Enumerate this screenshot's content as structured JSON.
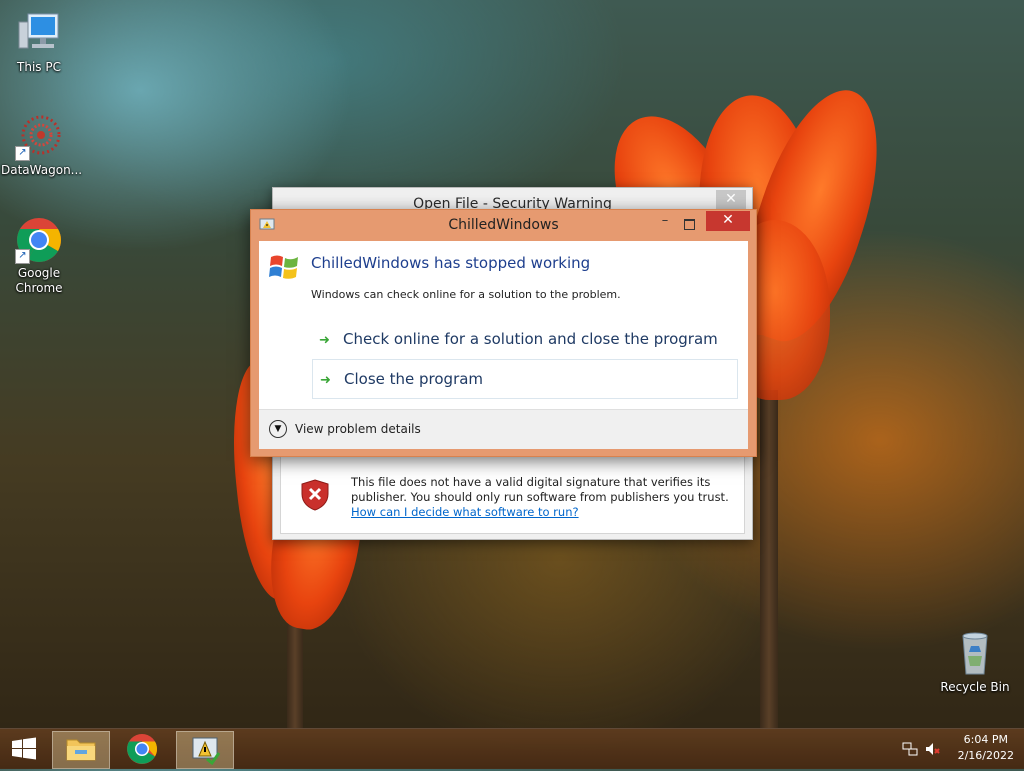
{
  "desktop": {
    "icons": [
      {
        "label": "This PC"
      },
      {
        "label": "DataWagon..."
      },
      {
        "label": "Google Chrome"
      },
      {
        "label": "Recycle Bin"
      }
    ]
  },
  "security_dialog": {
    "title": "Open File - Security Warning",
    "close_glyph": "✕",
    "message": "This file does not have a valid digital signature that verifies its publisher.  You should only run software from publishers you trust.",
    "link": "How can I decide what software to run?"
  },
  "error_dialog": {
    "title": "ChilledWindows",
    "minimize_glyph": "–",
    "close_glyph": "✕",
    "heading": "ChilledWindows has stopped working",
    "subtext": "Windows can check online for a solution to the problem.",
    "option_check": "Check online for a solution and close the program",
    "option_close": "Close the program",
    "details_label": "View problem details"
  },
  "taskbar": {
    "time": "6:04 PM",
    "date": "2/16/2022"
  },
  "colors": {
    "error_frame": "#e69a70",
    "close_red": "#c7372f",
    "link_blue": "#0066cc",
    "heading_blue": "#1e3f8e"
  }
}
